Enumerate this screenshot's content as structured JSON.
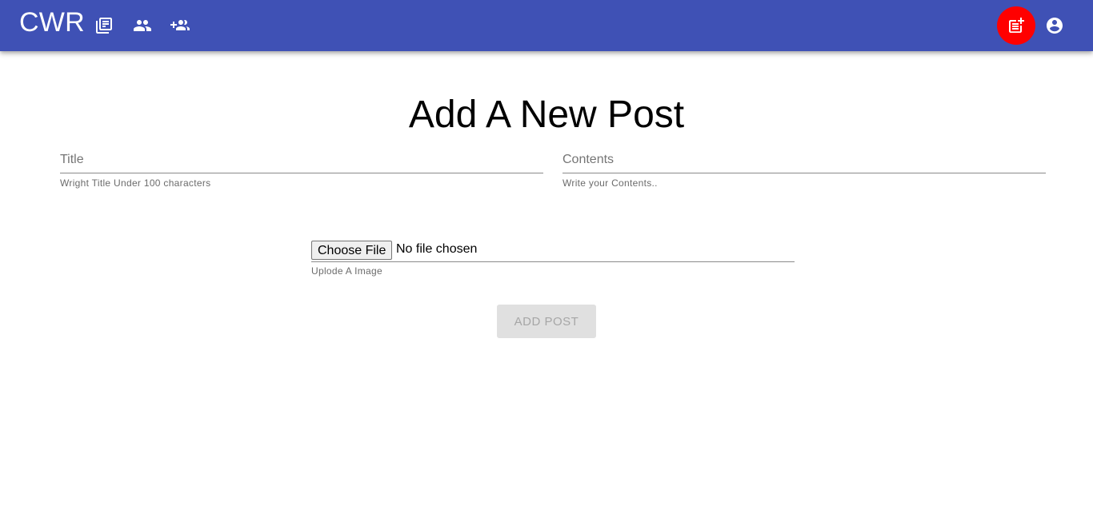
{
  "app": {
    "brand": "CWR",
    "nav": [
      {
        "icon": "library-icon"
      },
      {
        "icon": "people-icon"
      },
      {
        "icon": "group-add-icon"
      }
    ],
    "actions": [
      {
        "icon": "post-add-icon",
        "color": "#ff0000"
      },
      {
        "icon": "account-circle-icon"
      }
    ],
    "colors": {
      "appbar": "#3f51b5",
      "accent": "#ff0000"
    }
  },
  "page": {
    "title": "Add A New Post"
  },
  "form": {
    "title_field": {
      "placeholder": "Title",
      "value": "",
      "helper": "Wright Title Under 100 characters"
    },
    "contents_field": {
      "placeholder": "Contents",
      "value": "",
      "helper": "Write your Contents.."
    },
    "file_field": {
      "button": "Choose File",
      "status": "No file chosen",
      "helper": "Uplode A Image"
    },
    "submit": {
      "label": "ADD POST",
      "disabled": true
    }
  }
}
